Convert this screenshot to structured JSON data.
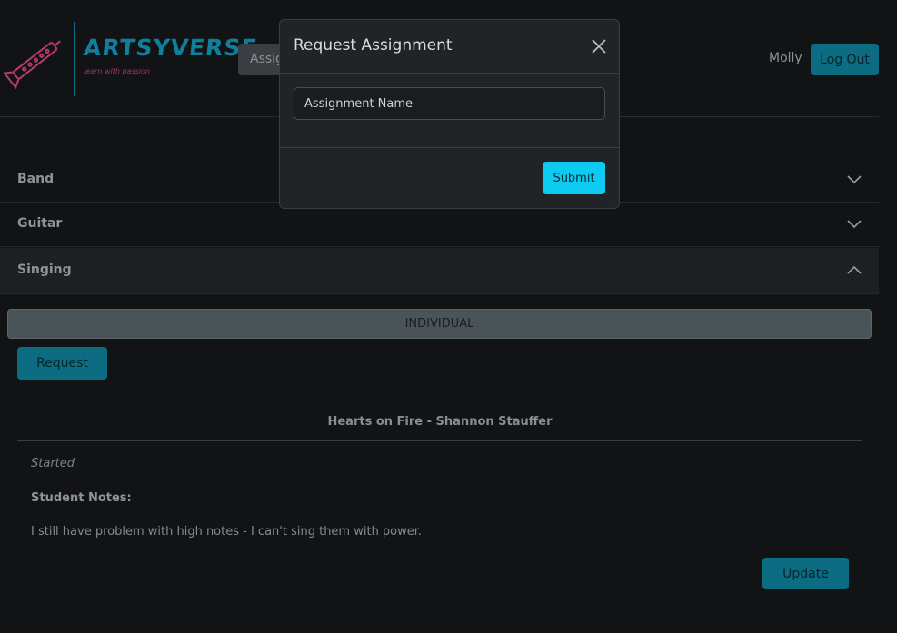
{
  "brand": {
    "name": "ARTSYVERSE",
    "tagline": "learn with passion",
    "accent": "#0f7f9c"
  },
  "nav": {
    "tab_label": "Assig"
  },
  "user": {
    "name": "Molly",
    "logout_label": "Log Out"
  },
  "accordion": [
    {
      "label": "Band",
      "expanded": false
    },
    {
      "label": "Guitar",
      "expanded": false
    },
    {
      "label": "Singing",
      "expanded": true
    }
  ],
  "singing": {
    "section_label": "INDIVIDUAL",
    "request_label": "Request",
    "assignment": {
      "title": "Hearts on Fire - Shannon Stauffer",
      "status": "Started",
      "notes_label": "Student Notes:",
      "notes": "I still have problem with high notes - I can't sing them with power.",
      "update_label": "Update"
    }
  },
  "modal": {
    "title": "Request Assignment",
    "input_placeholder": "Assignment Name",
    "input_value": "",
    "submit_label": "Submit"
  },
  "colors": {
    "background": "#121315",
    "button": "#0b6c82",
    "submit": "#0dcaf0"
  }
}
